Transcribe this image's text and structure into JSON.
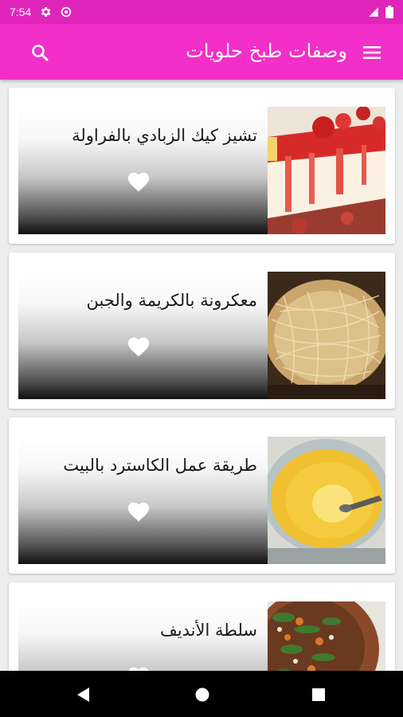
{
  "status_bar": {
    "time": "7:54"
  },
  "app_bar": {
    "title": "وصفات طبخ حلويات"
  },
  "recipes": [
    {
      "title": "تشيز كيك الزبادي بالفراولة"
    },
    {
      "title": "معكرونة بالكريمة والجبن"
    },
    {
      "title": "طريقة عمل الكاسترد بالبيت"
    },
    {
      "title": "سلطة الأنديف"
    }
  ],
  "colors": {
    "status_bar": "#e026ba",
    "app_bar": "#f22fc8"
  }
}
